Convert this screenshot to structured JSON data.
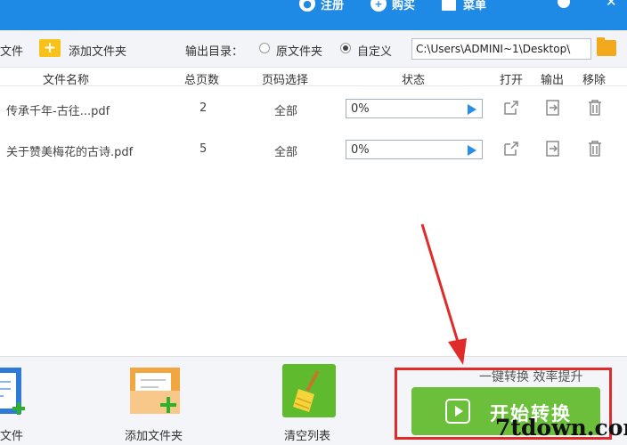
{
  "titlebar": {
    "register": "注册",
    "buy": "购买",
    "menu": "菜单"
  },
  "toolbar": {
    "add_file": "文件",
    "add_folder": "添加文件夹",
    "output_dir_label": "输出目录：",
    "option_original": "原文件夹",
    "option_custom": "自定义",
    "output_path": "C:\\Users\\ADMINI~1\\Desktop\\"
  },
  "table": {
    "headers": {
      "name": "文件名称",
      "pages": "总页数",
      "page_select": "页码选择",
      "status": "状态",
      "open": "打开",
      "output": "输出",
      "remove": "移除"
    },
    "rows": [
      {
        "name": "传承千年-古往...pdf",
        "pages": "2",
        "page_select": "全部",
        "progress_text": "0%",
        "progress": 0
      },
      {
        "name": "关于赞美梅花的古诗.pdf",
        "pages": "5",
        "page_select": "全部",
        "progress_text": "0%",
        "progress": 0
      }
    ]
  },
  "bottom": {
    "add_file": "文件",
    "add_folder": "添加文件夹",
    "clear_list": "清空列表",
    "slogan": "一键转换  效率提升",
    "start": "开始转换"
  },
  "watermark": "7tdown.com",
  "colors": {
    "titlebar": "#1e8ae6",
    "start_button": "#6bbf3a",
    "highlight": "#e02b2b",
    "folder": "#f8c21a"
  }
}
